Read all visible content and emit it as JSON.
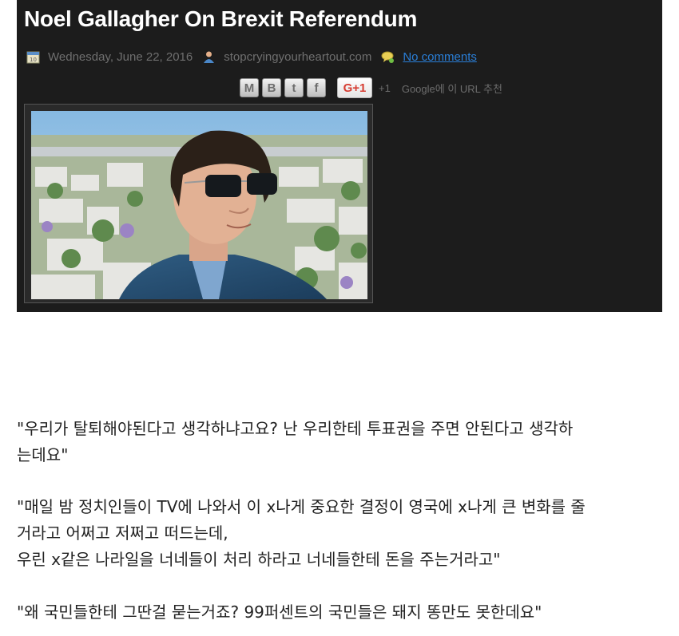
{
  "post": {
    "title": "Noel Gallagher On Brexit Referendum",
    "date": "Wednesday, June 22, 2016",
    "author": "stopcryingyourheartout.com",
    "comments_link": "No comments",
    "share": {
      "email_label": "M",
      "blog_label": "B",
      "twitter_label": "t",
      "facebook_label": "f",
      "gplus_label": "G+1",
      "plusone_label": "+1",
      "google_text": "Google에 이 URL 추천"
    }
  },
  "quotes": [
    "\"우리가 탈퇴해야된다고 생각하냐고요? 난 우리한테 투표권을 주면 안된다고 생각하",
    "는데요\"",
    "\"매일 밤 정치인들이 TV에 나와서 이 x나게 중요한 결정이 영국에 x나게 큰 변화를 줄",
    "거라고 어쩌고 저쩌고 떠드는데,",
    "우린 x같은 나라일을 너네들이 처리 하라고 너네들한테 돈을 주는거라고\"",
    "\"왜 국민들한테 그딴걸 묻는거죠? 99퍼센트의 국민들은 돼지 똥만도 못한데요\""
  ],
  "colors": {
    "panel": "#1c1c1c",
    "link": "#2a7fd8",
    "gplus": "#d73d32"
  },
  "icons": [
    "calendar-icon",
    "author-icon",
    "comments-icon",
    "email-share-icon",
    "blogger-share-icon",
    "twitter-share-icon",
    "facebook-share-icon"
  ]
}
